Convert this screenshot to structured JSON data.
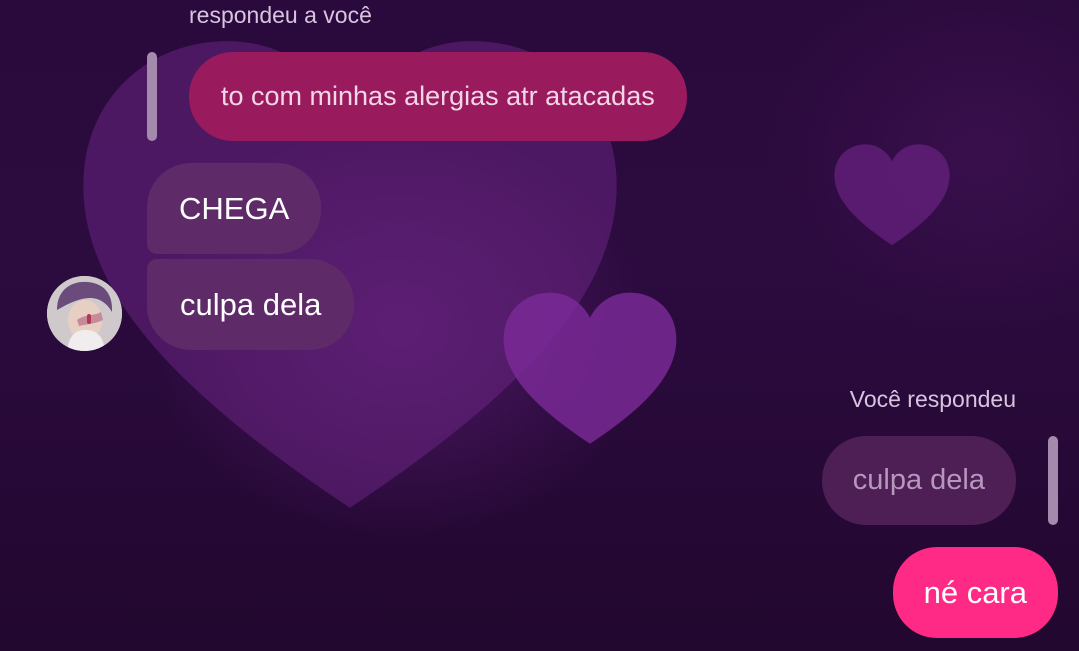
{
  "received": {
    "reply_caption": "respondeu a você",
    "quoted_message": "to com minhas alergias atr atacadas",
    "messages": [
      "CHEGA",
      "culpa dela"
    ],
    "avatar": "profile-photo-icon"
  },
  "sent": {
    "reply_caption": "Você respondeu",
    "quoted_message": "culpa dela",
    "message": "né cara"
  },
  "colors": {
    "background": "#2a0a3c",
    "received_bubble": "#5e2a68",
    "quoted_received_bubble": "#9a1a5e",
    "quoted_sent_bubble": "#4d1f55",
    "sent_bubble": "#ff2a86",
    "heart": "#7d2a9a"
  }
}
